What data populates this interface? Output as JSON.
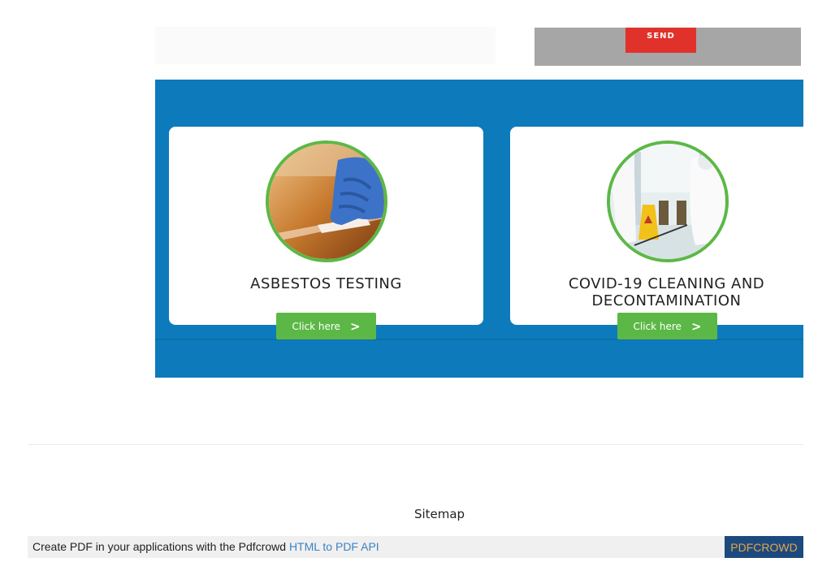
{
  "contact_form": {
    "send_label": "SEND"
  },
  "services": [
    {
      "title": "ASBESTOS TESTING",
      "image_alt": "gloved-hand-wiping-surface",
      "button_label": "Click here",
      "button_icon": ">"
    },
    {
      "title_line1": "COVID-19 CLEANING AND",
      "title_line2": "DECONTAMINATION",
      "image_alt": "hazmat-suit-cleaning-crew",
      "button_label": "Click here",
      "button_icon": ">"
    }
  ],
  "footer": {
    "sitemap_label": "Sitemap"
  },
  "pdf_banner": {
    "text": "Create PDF in your applications with the Pdfcrowd ",
    "link_text": "HTML to PDF API",
    "brand": "PDFCROWD"
  },
  "colors": {
    "band": "#0d7bbb",
    "accent_green": "#5cb846",
    "send_red": "#e0322a"
  }
}
